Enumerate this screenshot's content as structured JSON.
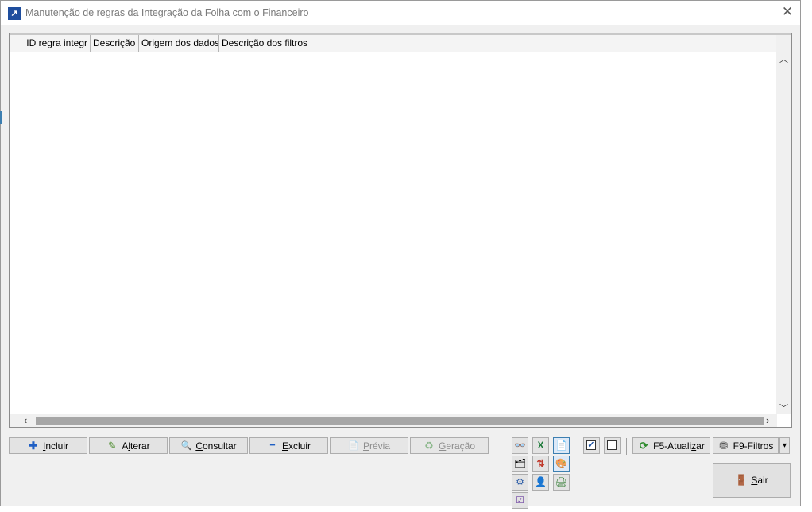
{
  "window": {
    "title": "Manutenção de regras da Integração da Folha com o Financeiro",
    "close_glyph": "✕"
  },
  "grid": {
    "columns": [
      "ID regra integr",
      "Descrição",
      "Origem dos dados",
      "Descrição dos filtros"
    ],
    "rows": []
  },
  "scroll": {
    "up": "︿",
    "down": "﹀",
    "left": "‹",
    "right": "›"
  },
  "actions": {
    "incluir": {
      "icon": "plus-icon",
      "glyph": "✚",
      "pre": "",
      "key": "I",
      "post": "ncluir"
    },
    "alterar": {
      "icon": "pencil-icon",
      "glyph": "✎",
      "pre": "A",
      "key": "l",
      "post": "terar"
    },
    "consultar": {
      "icon": "magnifier-icon",
      "glyph": "🔍",
      "pre": "",
      "key": "C",
      "post": "onsultar"
    },
    "excluir": {
      "icon": "minus-icon",
      "glyph": "━",
      "pre": "",
      "key": "E",
      "post": "xcluir"
    },
    "previa": {
      "icon": "document-icon",
      "glyph": "📄",
      "pre": "",
      "key": "P",
      "post": "révia"
    },
    "geracao": {
      "icon": "recycle-icon",
      "glyph": "♻",
      "pre": "",
      "key": "G",
      "post": "eração"
    }
  },
  "tool_icons": [
    {
      "name": "binoculars-icon",
      "glyph": "👓"
    },
    {
      "name": "excel-icon",
      "glyph": "X"
    },
    {
      "name": "report-icon",
      "glyph": "📄"
    },
    {
      "name": "folder-image-icon",
      "glyph": "🗂"
    },
    {
      "name": "sort-icon",
      "glyph": "⇅"
    },
    {
      "name": "palette-icon",
      "glyph": "🎨"
    },
    {
      "name": "settings-icon",
      "glyph": "⚙"
    },
    {
      "name": "user-icon",
      "glyph": "👤"
    },
    {
      "name": "printer-icon",
      "glyph": "🖨"
    },
    {
      "name": "checklist-icon",
      "glyph": "☑"
    }
  ],
  "checks": {
    "check_all": "✓",
    "uncheck_all": ""
  },
  "refresh": {
    "icon": "refresh-icon",
    "glyph": "⟳",
    "pre": "F5-Atuali",
    "key": "z",
    "post": "ar"
  },
  "filters": {
    "icon": "filter-icon",
    "glyph": "⛃",
    "label": "F9-Filtros",
    "dropdown_glyph": "▾"
  },
  "exit": {
    "icon": "exit-door-icon",
    "glyph": "🚪",
    "pre": "",
    "key": "S",
    "post": "air"
  },
  "colors": {
    "title_text": "#7a7a7a",
    "app_icon": "#1f4e9e",
    "selected_border": "#3c7fb1"
  }
}
